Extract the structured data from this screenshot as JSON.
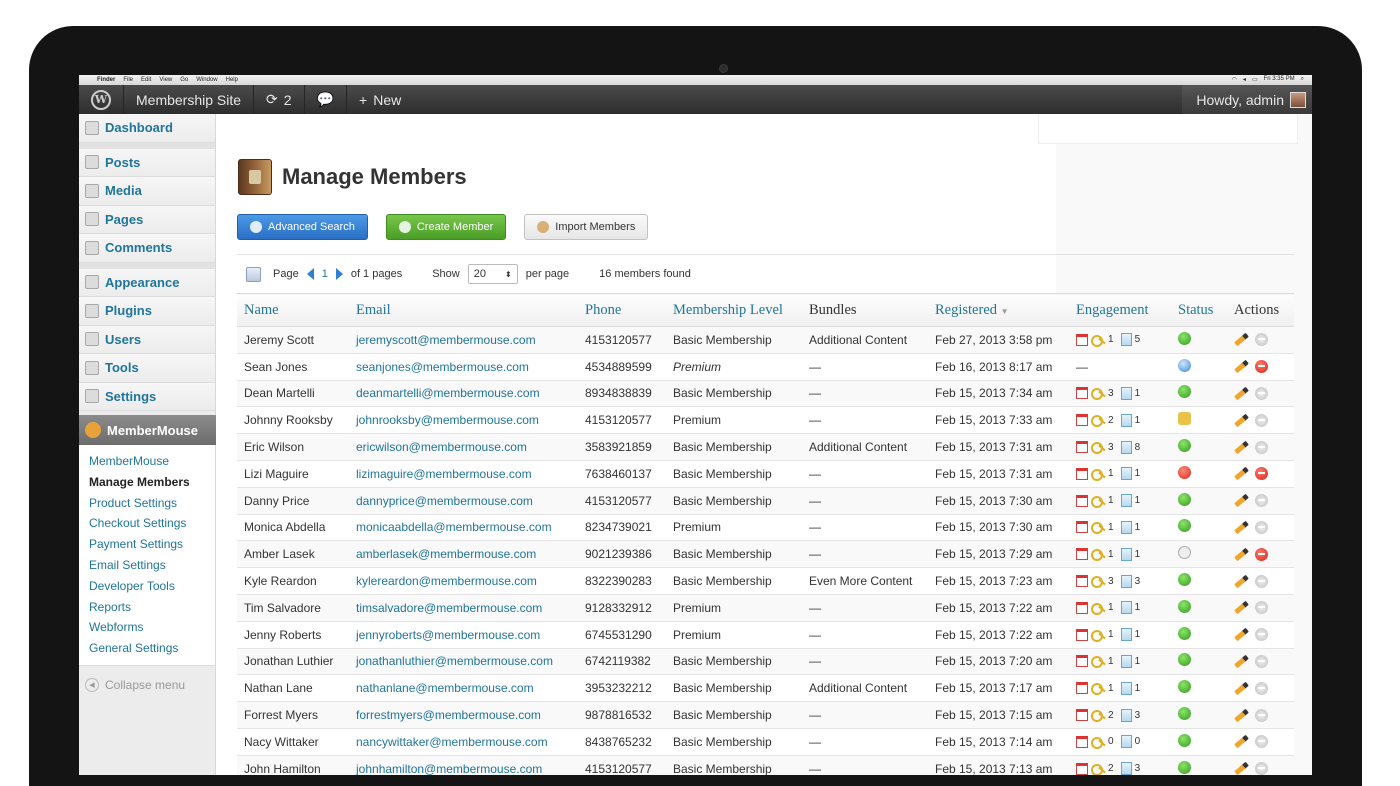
{
  "macbar": {
    "items": [
      "Finder",
      "File",
      "Edit",
      "View",
      "Go",
      "Window",
      "Help"
    ],
    "clock": "Fri 3:35 PM"
  },
  "adminbar": {
    "site": "Membership Site",
    "updates": "2",
    "new": "New",
    "howdy": "Howdy, admin"
  },
  "sidebar": {
    "menu": [
      "Dashboard",
      "Posts",
      "Media",
      "Pages",
      "Comments",
      "Appearance",
      "Plugins",
      "Users",
      "Tools",
      "Settings"
    ],
    "plugin": "MemberMouse",
    "submenu": [
      "MemberMouse",
      "Manage Members",
      "Product Settings",
      "Checkout Settings",
      "Payment Settings",
      "Email Settings",
      "Developer Tools",
      "Reports",
      "Webforms",
      "General Settings"
    ],
    "collapse": "Collapse menu"
  },
  "page": {
    "title": "Manage Members",
    "buttons": {
      "search": "Advanced Search",
      "create": "Create Member",
      "import": "Import Members"
    }
  },
  "pager": {
    "page_label": "Page",
    "page": "1",
    "of": "of 1 pages",
    "show_label": "Show",
    "show": "20",
    "per": "per page",
    "found": "16 members found"
  },
  "table": {
    "headers": [
      "Name",
      "Email",
      "Phone",
      "Membership Level",
      "Bundles",
      "Registered",
      "Engagement",
      "Status",
      "Actions"
    ],
    "rows": [
      {
        "name": "Jeremy Scott",
        "email": "jeremyscott@membermouse.com",
        "phone": "4153120577",
        "level": "Basic Membership",
        "bundles": "Additional Content",
        "registered": "Feb 27, 2013 3:58 pm",
        "logins": "1",
        "pages": "5",
        "status": "active",
        "del": "gray"
      },
      {
        "name": "Sean Jones",
        "email": "seanjones@membermouse.com",
        "phone": "4534889599",
        "level": "Premium",
        "bundles": "—",
        "registered": "Feb 16, 2013 8:17 am",
        "logins": "",
        "pages": "",
        "status": "pending",
        "del": "red"
      },
      {
        "name": "Dean Martelli",
        "email": "deanmartelli@membermouse.com",
        "phone": "8934838839",
        "level": "Basic Membership",
        "bundles": "—",
        "registered": "Feb 15, 2013 7:34 am",
        "logins": "3",
        "pages": "1",
        "status": "active",
        "del": "gray"
      },
      {
        "name": "Johnny Rooksby",
        "email": "johnrooksby@membermouse.com",
        "phone": "4153120577",
        "level": "Premium",
        "bundles": "—",
        "registered": "Feb 15, 2013 7:33 am",
        "logins": "2",
        "pages": "1",
        "status": "locked",
        "del": "gray"
      },
      {
        "name": "Eric Wilson",
        "email": "ericwilson@membermouse.com",
        "phone": "3583921859",
        "level": "Basic Membership",
        "bundles": "Additional Content",
        "registered": "Feb 15, 2013 7:31 am",
        "logins": "3",
        "pages": "8",
        "status": "active",
        "del": "gray"
      },
      {
        "name": "Lizi Maguire",
        "email": "lizimaguire@membermouse.com",
        "phone": "7638460137",
        "level": "Basic Membership",
        "bundles": "—",
        "registered": "Feb 15, 2013 7:31 am",
        "logins": "1",
        "pages": "1",
        "status": "canceled",
        "del": "red"
      },
      {
        "name": "Danny Price",
        "email": "dannyprice@membermouse.com",
        "phone": "4153120577",
        "level": "Basic Membership",
        "bundles": "—",
        "registered": "Feb 15, 2013 7:30 am",
        "logins": "1",
        "pages": "1",
        "status": "active",
        "del": "gray"
      },
      {
        "name": "Monica Abdella",
        "email": "monicaabdella@membermouse.com",
        "phone": "8234739021",
        "level": "Premium",
        "bundles": "—",
        "registered": "Feb 15, 2013 7:30 am",
        "logins": "1",
        "pages": "1",
        "status": "active",
        "del": "gray"
      },
      {
        "name": "Amber Lasek",
        "email": "amberlasek@membermouse.com",
        "phone": "9021239386",
        "level": "Basic Membership",
        "bundles": "—",
        "registered": "Feb 15, 2013 7:29 am",
        "logins": "1",
        "pages": "1",
        "status": "paused",
        "del": "red"
      },
      {
        "name": "Kyle Reardon",
        "email": "kylereardon@membermouse.com",
        "phone": "8322390283",
        "level": "Basic Membership",
        "bundles": "Even More Content",
        "registered": "Feb 15, 2013 7:23 am",
        "logins": "3",
        "pages": "3",
        "status": "active",
        "del": "gray"
      },
      {
        "name": "Tim Salvadore",
        "email": "timsalvadore@membermouse.com",
        "phone": "9128332912",
        "level": "Premium",
        "bundles": "—",
        "registered": "Feb 15, 2013 7:22 am",
        "logins": "1",
        "pages": "1",
        "status": "active",
        "del": "gray"
      },
      {
        "name": "Jenny Roberts",
        "email": "jennyroberts@membermouse.com",
        "phone": "6745531290",
        "level": "Premium",
        "bundles": "—",
        "registered": "Feb 15, 2013 7:22 am",
        "logins": "1",
        "pages": "1",
        "status": "active",
        "del": "gray"
      },
      {
        "name": "Jonathan Luthier",
        "email": "jonathanluthier@membermouse.com",
        "phone": "6742119382",
        "level": "Basic Membership",
        "bundles": "—",
        "registered": "Feb 15, 2013 7:20 am",
        "logins": "1",
        "pages": "1",
        "status": "active",
        "del": "gray"
      },
      {
        "name": "Nathan Lane",
        "email": "nathanlane@membermouse.com",
        "phone": "3953232212",
        "level": "Basic Membership",
        "bundles": "Additional Content",
        "registered": "Feb 15, 2013 7:17 am",
        "logins": "1",
        "pages": "1",
        "status": "active",
        "del": "gray"
      },
      {
        "name": "Forrest Myers",
        "email": "forrestmyers@membermouse.com",
        "phone": "9878816532",
        "level": "Basic Membership",
        "bundles": "—",
        "registered": "Feb 15, 2013 7:15 am",
        "logins": "2",
        "pages": "3",
        "status": "active",
        "del": "gray"
      },
      {
        "name": "Nacy Wittaker",
        "email": "nancywittaker@membermouse.com",
        "phone": "8438765232",
        "level": "Basic Membership",
        "bundles": "—",
        "registered": "Feb 15, 2013 7:14 am",
        "logins": "0",
        "pages": "0",
        "status": "active",
        "del": "gray"
      },
      {
        "name": "John Hamilton",
        "email": "johnhamilton@membermouse.com",
        "phone": "4153120577",
        "level": "Basic Membership",
        "bundles": "—",
        "registered": "Feb 15, 2013 7:13 am",
        "logins": "2",
        "pages": "3",
        "status": "active",
        "del": "gray"
      }
    ]
  },
  "colors": {
    "link": "#21759b",
    "primary_button": "#2a6fc6",
    "create_button": "#4a9e26"
  }
}
